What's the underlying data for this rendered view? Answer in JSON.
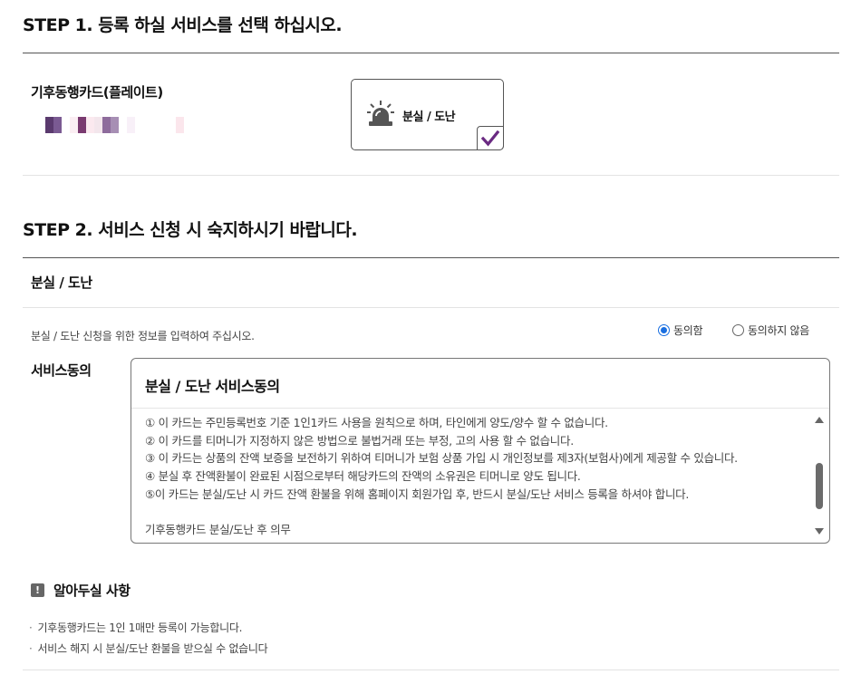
{
  "step1": {
    "title": "STEP 1. 등록 하실 서비스를 선택 하십시오.",
    "card_name": "기후동행카드(플레이트)",
    "service_option": {
      "label": "분실 / 도난",
      "icon": "siren-icon",
      "checked": true,
      "check_color": "#6a2a82"
    }
  },
  "step2": {
    "title": "STEP 2. 서비스 신청 시 숙지하시기 바랍니다.",
    "section_title": "분실 / 도난",
    "guide_text": "분실 / 도난 신청을 위한 정보를 입력하여 주십시오.",
    "agree_label": "동의함",
    "disagree_label": "동의하지 않음",
    "selected": "agree",
    "consent_label": "서비스동의",
    "terms": {
      "title": "분실 / 도난 서비스동의",
      "lines": [
        "① 이 카드는 주민등록번호 기준 1인1카드 사용을 원칙으로 하며, 타인에게 양도/양수 할 수 없습니다.",
        "② 이 카드를 티머니가 지정하지 않은 방법으로 불법거래 또는 부정, 고의 사용 할 수 없습니다.",
        "③ 이 카드는 상품의 잔액 보증을 보전하기 위하여 티머니가 보험 상품 가입 시 개인정보를 제3자(보험사)에게 제공할 수 있습니다.",
        "④ 분실 후 잔액환불이 완료된 시점으로부터 해당카드의 잔액의 소유권은 티머니로 양도 됩니다.",
        "⑤이 카드는 분실/도난 시 카드 잔액 환불을 위해 홈페이지 회원가입 후, 반드시 분실/도난 서비스 등록을 하셔야 합니다.",
        "",
        "기후동행카드 분실/도난 후 의무"
      ]
    }
  },
  "notice": {
    "icon": "exclamation-icon",
    "title": "알아두실 사항",
    "items": [
      "기후동행카드는 1인 1매만 등록이 가능합니다.",
      "서비스 해지 시 분실/도난 환불을 받으실 수 없습니다"
    ]
  }
}
